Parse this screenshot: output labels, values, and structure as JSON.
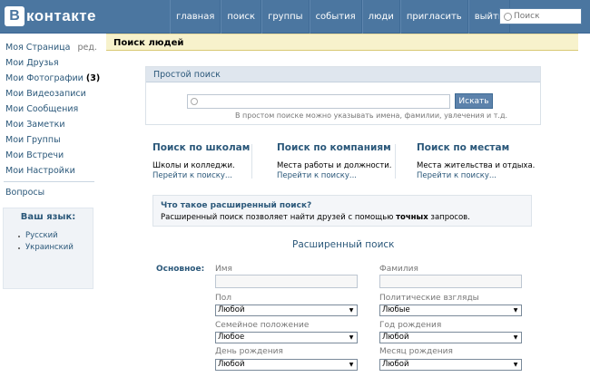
{
  "header": {
    "logo_letter": "В",
    "logo_text": "контакте",
    "nav": [
      "главная",
      "поиск",
      "группы",
      "события",
      "люди",
      "пригласить",
      "выйти"
    ],
    "search_placeholder": "Поиск"
  },
  "sidebar": {
    "items": [
      {
        "label": "Моя Страница",
        "extra": "ред."
      },
      {
        "label": "Мои Друзья"
      },
      {
        "label": "Мои Фотографии",
        "count": "(3)"
      },
      {
        "label": "Мои Видеозаписи"
      },
      {
        "label": "Мои Сообщения"
      },
      {
        "label": "Мои Заметки"
      },
      {
        "label": "Мои Группы"
      },
      {
        "label": "Мои Встречи"
      },
      {
        "label": "Мои Настройки"
      }
    ],
    "questions": "Вопросы",
    "language": {
      "title": "Ваш язык:",
      "options": [
        "Русский",
        "Украинский"
      ]
    }
  },
  "main": {
    "title": "Поиск людей",
    "simple": {
      "header": "Простой поиск",
      "button": "Искать",
      "hint": "В простом поиске можно указывать имена, фамилии, увлечения и т.д."
    },
    "columns": [
      {
        "title": "Поиск по школам",
        "desc": "Школы и колледжи.",
        "link": "Перейти к поиску..."
      },
      {
        "title": "Поиск по компаниям",
        "desc": "Места работы и должности.",
        "link": "Перейти к поиску..."
      },
      {
        "title": "Поиск по местам",
        "desc": "Места жительства и отдыха.",
        "link": "Перейти к поиску..."
      }
    ],
    "advanced_info": {
      "question": "Что такое расширенный поиск?",
      "answer_before": "Расширенный поиск позволяет найти друзей с помощью ",
      "answer_bold": "точных",
      "answer_after": " запросов."
    },
    "advanced_title": "Расширенный поиск",
    "form": {
      "section_label": "Основное:",
      "name_label": "Имя",
      "surname_label": "Фамилия",
      "gender_label": "Пол",
      "gender_value": "Любой",
      "politics_label": "Политические взгляды",
      "politics_value": "Любые",
      "marital_label": "Семейное положение",
      "marital_value": "Любое",
      "birth_year_label": "Год рождения",
      "birth_year_value": "Любой",
      "birth_day_label": "День рождения",
      "birth_day_value": "Любой",
      "birth_month_label": "Месяц рождения",
      "birth_month_value": "Любой"
    }
  }
}
